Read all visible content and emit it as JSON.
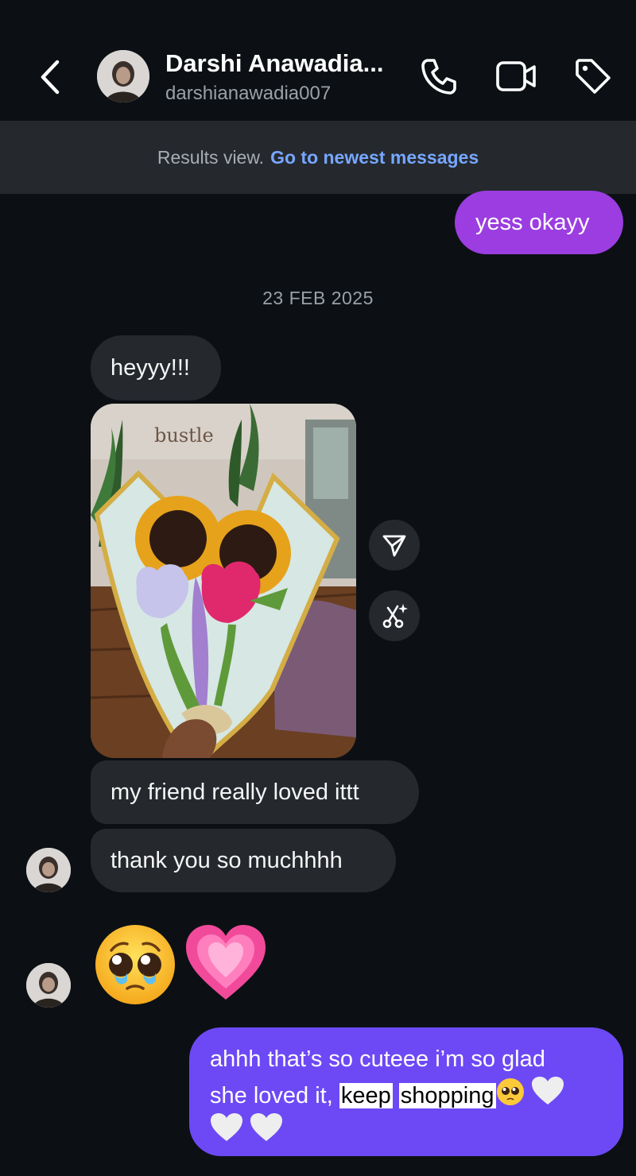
{
  "header": {
    "title": "Darshi Anawadia...",
    "username": "darshianawadia007"
  },
  "banner": {
    "text": "Results view.",
    "link": "Go to newest messages"
  },
  "messages": {
    "out1": "yess okayy",
    "date": "23 FEB 2025",
    "in1": "heyyy!!!",
    "photo_sign": "bustle",
    "in2": "my friend really loved ittt",
    "in3": "thank you so muchhhh",
    "out2_line1": "ahhh that’s so cuteee i’m so glad",
    "out2_prefix": "she loved it,",
    "out2_keep": "keep",
    "out2_shopping": "shopping"
  },
  "colors": {
    "background": "#0c1014",
    "incoming_bubble": "#25292e",
    "outgoing_purple": "#9b3de0",
    "outgoing_violet": "#6d49f5",
    "link": "#77a7ff"
  }
}
